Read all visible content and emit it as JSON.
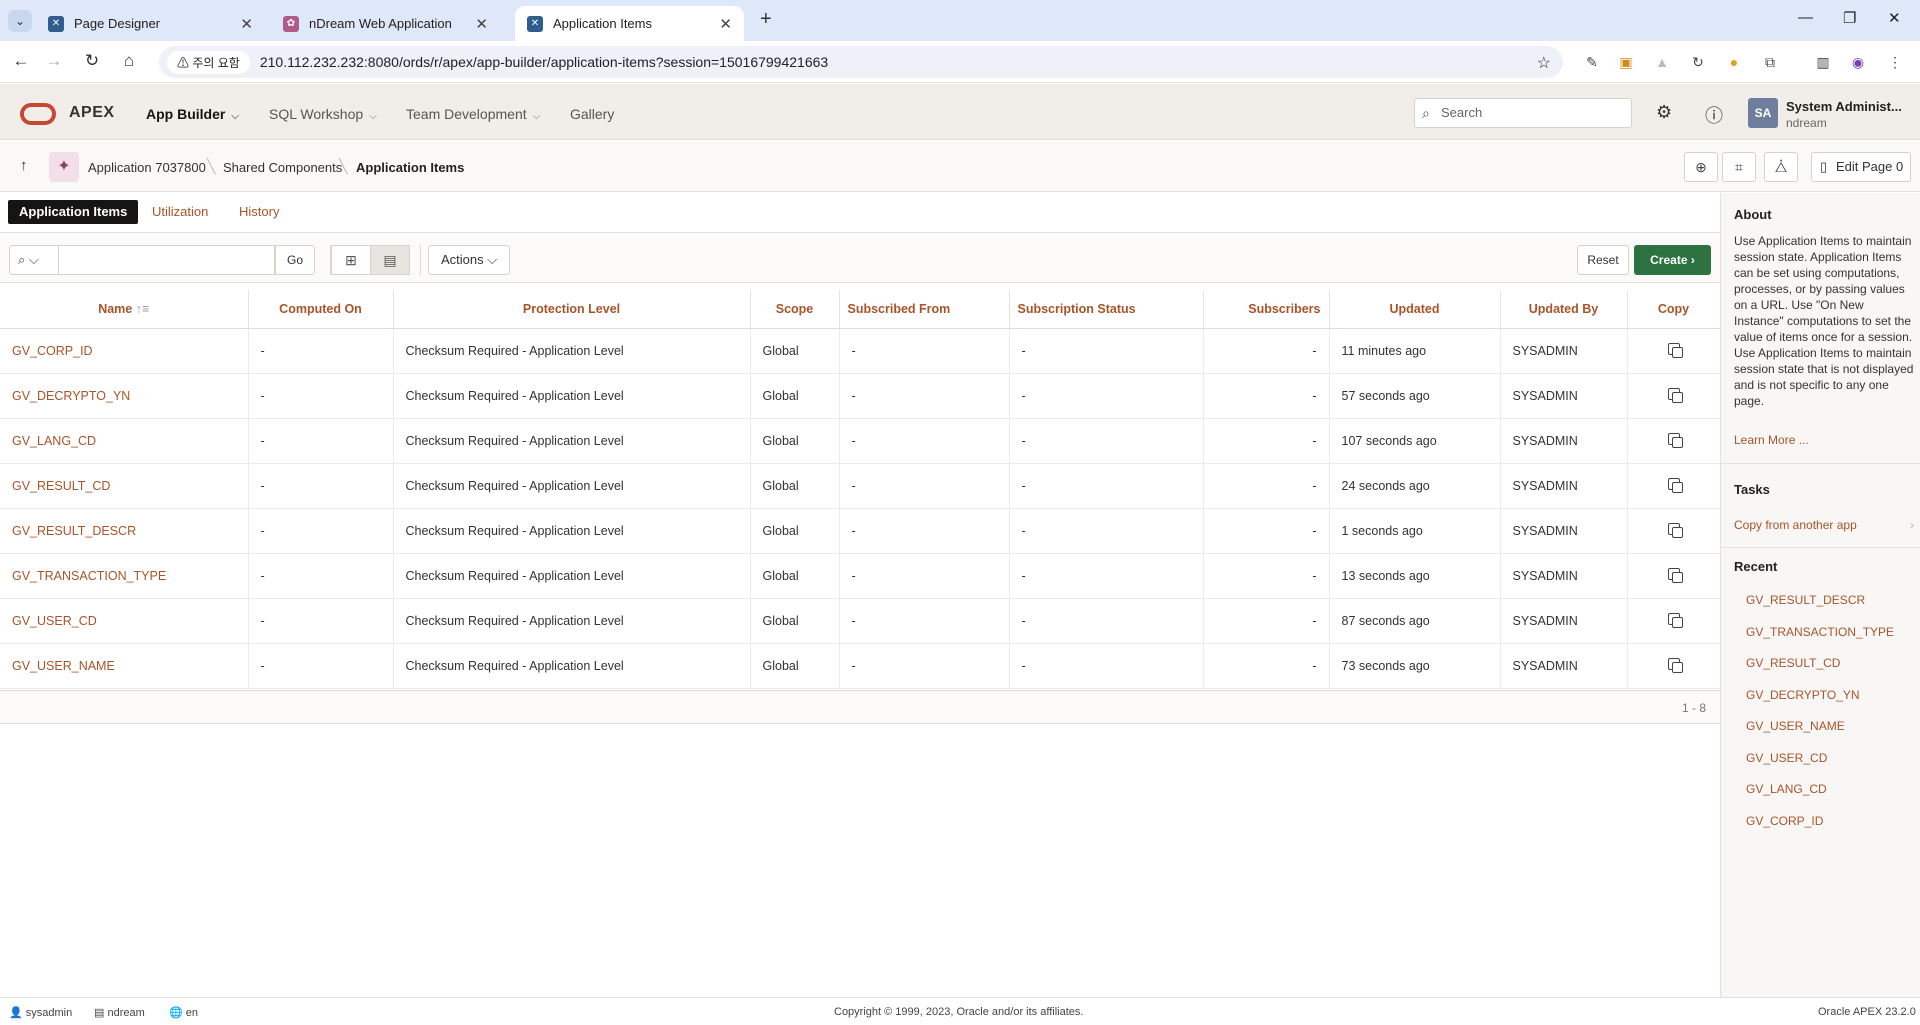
{
  "browser": {
    "tabs": [
      {
        "title": "Page Designer",
        "active": false
      },
      {
        "title": "nDream Web Application",
        "active": false
      },
      {
        "title": "Application Items",
        "active": true
      }
    ],
    "url_warning": "주의 요함",
    "url": "210.112.232.232:8080/ords/r/apex/app-builder/application-items?session=15016799421663"
  },
  "header": {
    "logo": "APEX",
    "nav": [
      "App Builder",
      "SQL Workshop",
      "Team Development",
      "Gallery"
    ],
    "search_placeholder": "Search",
    "avatar_initials": "SA",
    "user_name": "System Administ...",
    "user_workspace": "ndream"
  },
  "breadcrumb": {
    "items": [
      "Application 7037800",
      "Shared Components",
      "Application Items"
    ],
    "edit_page": "Edit Page 0"
  },
  "subtabs": [
    "Application Items",
    "Utilization",
    "History"
  ],
  "toolbar": {
    "go": "Go",
    "actions": "Actions",
    "reset": "Reset",
    "create": "Create"
  },
  "table": {
    "columns": [
      "Name",
      "Computed On",
      "Protection Level",
      "Scope",
      "Subscribed From",
      "Subscription Status",
      "Subscribers",
      "Updated",
      "Updated By",
      "Copy"
    ],
    "rows": [
      {
        "name": "GV_CORP_ID",
        "computed": "-",
        "protection": "Checksum Required - Application Level",
        "scope": "Global",
        "from": "-",
        "status": "-",
        "subs": "-",
        "updated": "11 minutes ago",
        "by": "SYSADMIN"
      },
      {
        "name": "GV_DECRYPTO_YN",
        "computed": "-",
        "protection": "Checksum Required - Application Level",
        "scope": "Global",
        "from": "-",
        "status": "-",
        "subs": "-",
        "updated": "57 seconds ago",
        "by": "SYSADMIN"
      },
      {
        "name": "GV_LANG_CD",
        "computed": "-",
        "protection": "Checksum Required - Application Level",
        "scope": "Global",
        "from": "-",
        "status": "-",
        "subs": "-",
        "updated": "107 seconds ago",
        "by": "SYSADMIN"
      },
      {
        "name": "GV_RESULT_CD",
        "computed": "-",
        "protection": "Checksum Required - Application Level",
        "scope": "Global",
        "from": "-",
        "status": "-",
        "subs": "-",
        "updated": "24 seconds ago",
        "by": "SYSADMIN"
      },
      {
        "name": "GV_RESULT_DESCR",
        "computed": "-",
        "protection": "Checksum Required - Application Level",
        "scope": "Global",
        "from": "-",
        "status": "-",
        "subs": "-",
        "updated": "1 seconds ago",
        "by": "SYSADMIN"
      },
      {
        "name": "GV_TRANSACTION_TYPE",
        "computed": "-",
        "protection": "Checksum Required - Application Level",
        "scope": "Global",
        "from": "-",
        "status": "-",
        "subs": "-",
        "updated": "13 seconds ago",
        "by": "SYSADMIN"
      },
      {
        "name": "GV_USER_CD",
        "computed": "-",
        "protection": "Checksum Required - Application Level",
        "scope": "Global",
        "from": "-",
        "status": "-",
        "subs": "-",
        "updated": "87 seconds ago",
        "by": "SYSADMIN"
      },
      {
        "name": "GV_USER_NAME",
        "computed": "-",
        "protection": "Checksum Required - Application Level",
        "scope": "Global",
        "from": "-",
        "status": "-",
        "subs": "-",
        "updated": "73 seconds ago",
        "by": "SYSADMIN"
      }
    ],
    "pagination": "1 - 8"
  },
  "sidebar": {
    "about_title": "About",
    "about_text": "Use Application Items to maintain session state. Application Items can be set using computations, processes, or by passing values on a URL. Use \"On New Instance\" computations to set the value of items once for a session. Use Application Items to maintain session state that is not displayed and is not specific to any one page.",
    "learn_more": "Learn More ...",
    "tasks_title": "Tasks",
    "task": "Copy from another app",
    "recent_title": "Recent",
    "recent": [
      "GV_RESULT_DESCR",
      "GV_TRANSACTION_TYPE",
      "GV_RESULT_CD",
      "GV_DECRYPTO_YN",
      "GV_USER_NAME",
      "GV_USER_CD",
      "GV_LANG_CD",
      "GV_CORP_ID"
    ]
  },
  "footer": {
    "user": "sysadmin",
    "workspace": "ndream",
    "lang": "en",
    "copyright": "Copyright © 1999, 2023, Oracle and/or its affiliates.",
    "version": "Oracle APEX 23.2.0"
  },
  "colors": {
    "accent": "#a8542a",
    "create": "#2d7341",
    "oracle_red": "#c74634"
  }
}
